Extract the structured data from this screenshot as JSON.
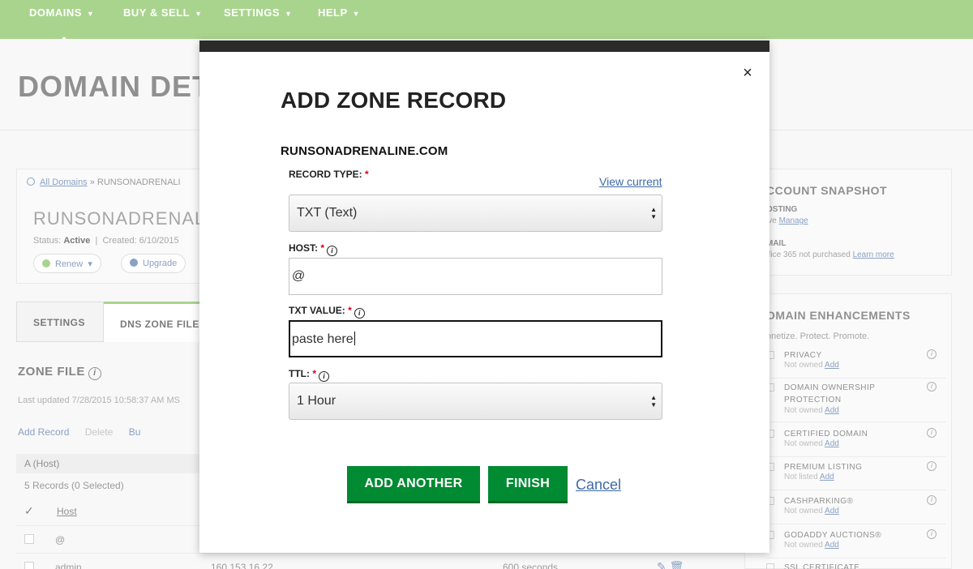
{
  "nav": {
    "items": [
      {
        "label": "DOMAINS"
      },
      {
        "label": "BUY & SELL"
      },
      {
        "label": "SETTINGS"
      },
      {
        "label": "HELP"
      }
    ]
  },
  "page": {
    "title": "DOMAIN DET",
    "breadcrumb_link": "All Domains",
    "breadcrumb_current": "» RUNSONADRENALI",
    "domain_name": "RUNSONADRENALI",
    "status_label": "Status:",
    "status_value": "Active",
    "created": "Created: 6/10/2015",
    "renew_label": "Renew",
    "upgrade_label": "Upgrade"
  },
  "tabs": [
    {
      "label": "SETTINGS"
    },
    {
      "label": "DNS ZONE FILE"
    }
  ],
  "zone": {
    "title": "ZONE FILE",
    "last_updated": "Last updated 7/28/2015 10:58:37 AM MS",
    "add_record": "Add Record",
    "delete": "Delete",
    "bulk": "Bu",
    "a_host": "A (Host)",
    "records_count": "5 Records (0 Selected)",
    "col_host": "Host",
    "rows": [
      {
        "host": "@",
        "points_to": "",
        "ttl": ""
      },
      {
        "host": "admin",
        "points_to": "160.153.16.22",
        "ttl": "600 seconds"
      }
    ]
  },
  "sidebar": {
    "snapshot_title": "CCOUNT SNAPSHOT",
    "hosting_label": "OSTING",
    "hosting_text": "ive",
    "hosting_link": "Manage",
    "email_label": "MAIL",
    "email_text": "ffice 365 not purchased",
    "email_link": "Learn more",
    "enh_title": "OMAIN ENHANCEMENTS",
    "enh_sub": "onetize. Protect. Promote.",
    "enhancements": [
      {
        "name": "PRIVACY",
        "status": "Not owned",
        "link": "Add"
      },
      {
        "name": "DOMAIN OWNERSHIP PROTECTION",
        "status": "Not owned",
        "link": "Add"
      },
      {
        "name": "CERTIFIED DOMAIN",
        "status": "Not owned",
        "link": "Add"
      },
      {
        "name": "PREMIUM LISTING",
        "status": "Not listed",
        "link": "Add"
      },
      {
        "name": "CASHPARKING®",
        "status": "Not owned",
        "link": "Add"
      },
      {
        "name": "GODADDY AUCTIONS®",
        "status": "Not owned",
        "link": "Add"
      },
      {
        "name": "SSL CERTIFICATE",
        "status": "",
        "link": ""
      }
    ]
  },
  "modal": {
    "title": "ADD ZONE RECORD",
    "domain": "RUNSONADRENALINE.COM",
    "record_type_label": "RECORD TYPE:",
    "view_current": "View current",
    "record_type_value": "TXT (Text)",
    "host_label": "HOST:",
    "host_value": "@",
    "txt_label": "TXT VALUE:",
    "txt_value": "paste here",
    "ttl_label": "TTL:",
    "ttl_value": "1 Hour",
    "add_another": "ADD ANOTHER",
    "finish": "FINISH",
    "cancel": "Cancel",
    "close_glyph": "×",
    "required_mark": "*",
    "info_glyph": "i"
  },
  "colors": {
    "nav_green": "#7cbd52",
    "button_green": "#008a32",
    "link_blue": "#3e6aa8",
    "required_red": "#d0021b",
    "modal_topbar": "#2b2b2b"
  }
}
